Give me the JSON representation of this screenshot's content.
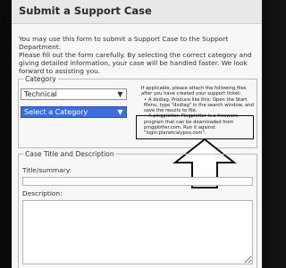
{
  "page": {
    "title": "Submit a Support Case",
    "intro": "You may use this form to submit a Support Case to the Support Department.",
    "description": "Please fill out the form carefully. By selecting the correct category and giving detailed information, your case will be handled faster. We look forward to assisting you."
  },
  "category": {
    "legend": "Category",
    "type_select": {
      "value": "Technical",
      "arrow_icon": "chevron-down-icon"
    },
    "category_select": {
      "value": "Select a Category",
      "arrow_icon": "chevron-down-icon",
      "highlight_color": "#3c6de0"
    }
  },
  "attachments": {
    "intro": "If applicable, please attach the following files after you have created your support ticket:",
    "items": [
      "A dxdiag. Produce like this: Open the Start Menu, type \"dxdiag\" in the search window, and save the results to file.",
      "A pingplotter. Pingplotter is a freeware program that can be downloaded from pingplotter.com. Run it against \"login.planetcalypso.com\"."
    ]
  },
  "case": {
    "legend": "Case Title and Description",
    "title_label": "Title/summary:",
    "title_value": "",
    "description_label": "Description:",
    "description_value": ""
  },
  "annotation": {
    "highlight_icon": "highlight-box",
    "arrow_icon": "up-arrow-icon"
  }
}
